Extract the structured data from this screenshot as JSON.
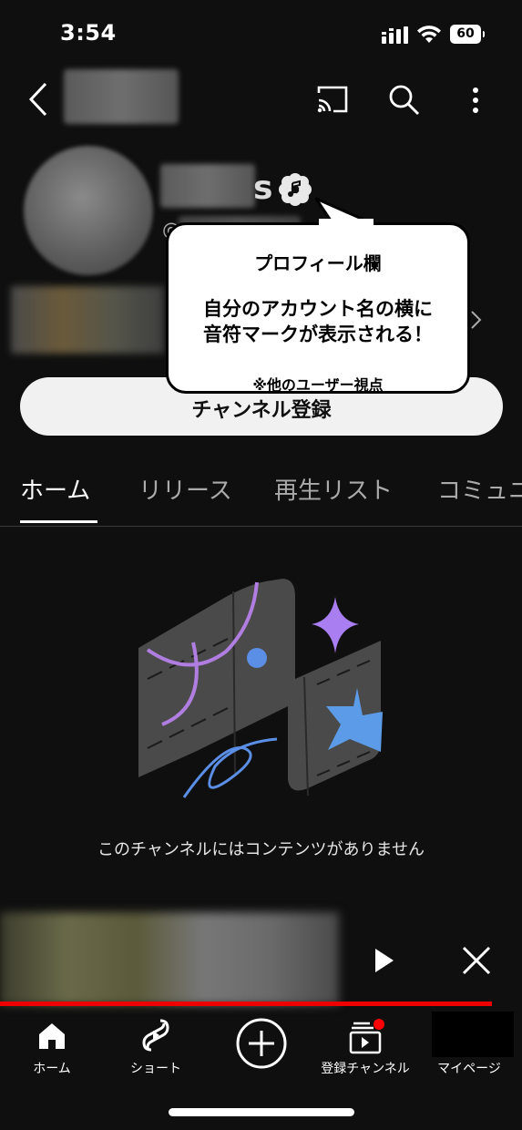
{
  "status_bar": {
    "time": "3:54",
    "battery": "60"
  },
  "channel": {
    "name_visible_suffix": "s",
    "handle_prefix": "@",
    "subscribe_label": "チャンネル登録"
  },
  "callout": {
    "title": "プロフィール欄",
    "line1": "自分のアカウント名の横に",
    "line2": "音符マークが表示される！",
    "note": "※他のユーザー視点"
  },
  "tabs": [
    {
      "label": "ホーム",
      "active": true
    },
    {
      "label": "リリース",
      "active": false
    },
    {
      "label": "再生リスト",
      "active": false
    },
    {
      "label": "コミュニ",
      "active": false
    }
  ],
  "empty_state": {
    "message": "このチャンネルにはコンテンツがありません"
  },
  "bottom_nav": [
    {
      "label": "ホーム",
      "icon": "home-icon"
    },
    {
      "label": "ショート",
      "icon": "shorts-icon"
    },
    {
      "label": "",
      "icon": "create-icon"
    },
    {
      "label": "登録チャンネル",
      "icon": "subscriptions-icon"
    },
    {
      "label": "マイページ",
      "icon": "avatar"
    }
  ],
  "colors": {
    "background": "#0f0f0f",
    "progress": "#ee0000",
    "notification_dot": "#ff0000"
  }
}
